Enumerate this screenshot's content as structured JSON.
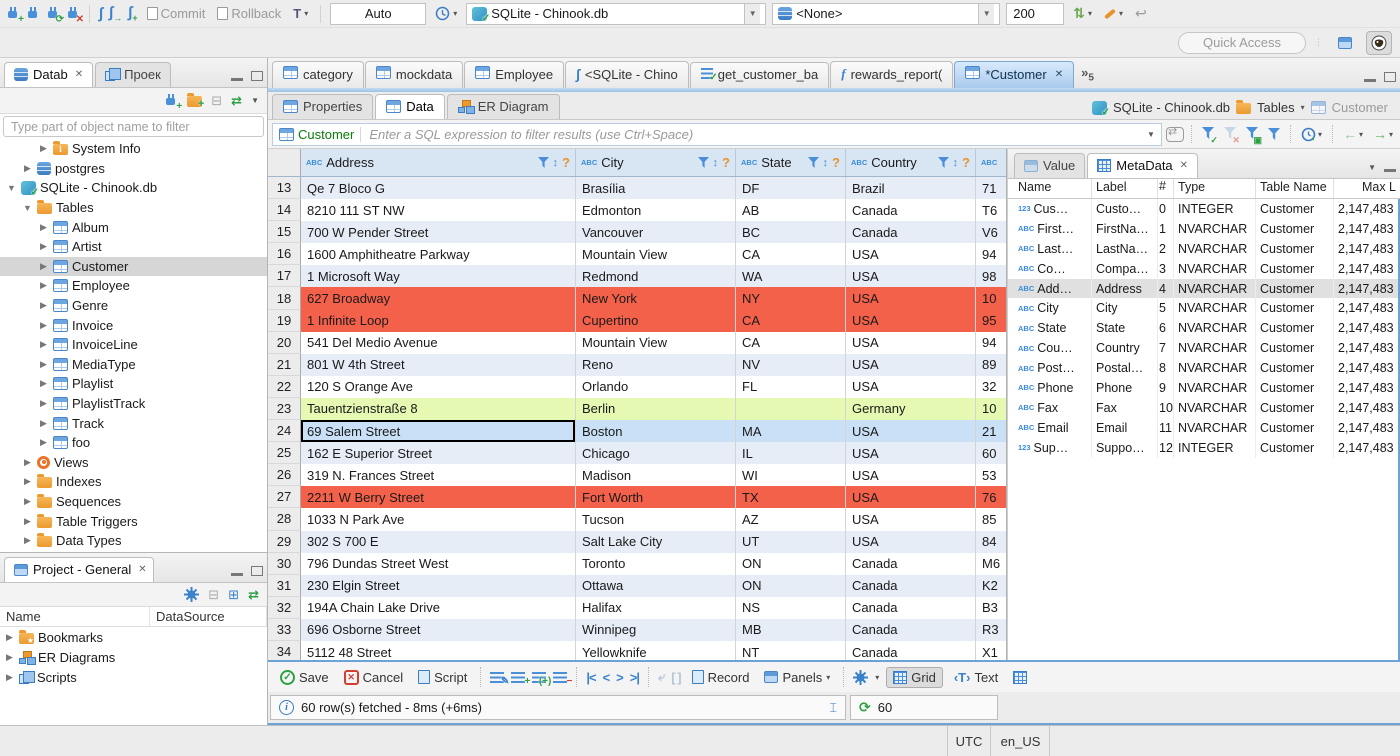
{
  "toolbar": {
    "commit_label": "Commit",
    "rollback_label": "Rollback",
    "txn_mode": "Auto",
    "connection_value": "SQLite - Chinook.db",
    "schema_value": "<None>",
    "fetch_size": "200"
  },
  "quick_access": {
    "placeholder": "Quick Access"
  },
  "navigator": {
    "tab_database": "Datab",
    "tab_project": "Проек",
    "filter_placeholder": "Type part of object name to filter",
    "tree": [
      {
        "exp": "▶",
        "icon": "i-folder i-folder-info",
        "label": "System Info",
        "lvl": 2
      },
      {
        "exp": "▶",
        "icon": "i-db",
        "label": "postgres",
        "lvl": 1
      },
      {
        "exp": "▼",
        "icon": "i-db-green",
        "label": "SQLite - Chinook.db",
        "lvl": 0
      },
      {
        "exp": "▼",
        "icon": "i-folder",
        "label": "Tables",
        "lvl": 1
      },
      {
        "exp": "▶",
        "icon": "i-table",
        "label": "Album",
        "lvl": 2
      },
      {
        "exp": "▶",
        "icon": "i-table",
        "label": "Artist",
        "lvl": 2
      },
      {
        "exp": "▶",
        "icon": "i-table",
        "label": "Customer",
        "lvl": 2,
        "cls": "selected"
      },
      {
        "exp": "▶",
        "icon": "i-table",
        "label": "Employee",
        "lvl": 2
      },
      {
        "exp": "▶",
        "icon": "i-table",
        "label": "Genre",
        "lvl": 2
      },
      {
        "exp": "▶",
        "icon": "i-table",
        "label": "Invoice",
        "lvl": 2
      },
      {
        "exp": "▶",
        "icon": "i-table",
        "label": "InvoiceLine",
        "lvl": 2
      },
      {
        "exp": "▶",
        "icon": "i-table",
        "label": "MediaType",
        "lvl": 2
      },
      {
        "exp": "▶",
        "icon": "i-table",
        "label": "Playlist",
        "lvl": 2
      },
      {
        "exp": "▶",
        "icon": "i-table",
        "label": "PlaylistTrack",
        "lvl": 2
      },
      {
        "exp": "▶",
        "icon": "i-table",
        "label": "Track",
        "lvl": 2
      },
      {
        "exp": "▶",
        "icon": "i-table",
        "label": "foo",
        "lvl": 2
      },
      {
        "exp": "▶",
        "icon": "i-eye",
        "label": "Views",
        "lvl": 1
      },
      {
        "exp": "▶",
        "icon": "i-folder",
        "label": "Indexes",
        "lvl": 1
      },
      {
        "exp": "▶",
        "icon": "i-folder",
        "label": "Sequences",
        "lvl": 1
      },
      {
        "exp": "▶",
        "icon": "i-folder",
        "label": "Table Triggers",
        "lvl": 1
      },
      {
        "exp": "▶",
        "icon": "i-folder",
        "label": "Data Types",
        "lvl": 1
      }
    ]
  },
  "project_panel": {
    "title": "Project - General",
    "col_name": "Name",
    "col_datasource": "DataSource",
    "items": [
      {
        "icon": "i-folder i-folder-star",
        "label": "Bookmarks"
      },
      {
        "icon": "i-er",
        "label": "ER Diagrams"
      },
      {
        "icon": "i-pages",
        "label": "Scripts"
      }
    ]
  },
  "editor": {
    "tabs": [
      {
        "icon": "table",
        "label": "category"
      },
      {
        "icon": "table",
        "label": "mockdata"
      },
      {
        "icon": "table",
        "label": "Employee"
      },
      {
        "icon": "sql",
        "label": "<SQLite - Chino"
      },
      {
        "icon": "script",
        "label": "get_customer_ba"
      },
      {
        "icon": "func",
        "label": "rewards_report("
      },
      {
        "icon": "table",
        "label": "*Customer",
        "cls": "active",
        "close": "✕"
      }
    ],
    "overflow_count": "5",
    "subtabs": {
      "properties": "Properties",
      "data": "Data",
      "er": "ER Diagram"
    },
    "breadcrumb": {
      "connection": "SQLite - Chinook.db",
      "container": "Tables",
      "entity": "Customer"
    }
  },
  "filter_bar": {
    "entity": "Customer",
    "placeholder": "Enter a SQL expression to filter results (use Ctrl+Space)"
  },
  "grid": {
    "columns": [
      {
        "label": "Address"
      },
      {
        "label": "City"
      },
      {
        "label": "State"
      },
      {
        "label": "Country"
      }
    ],
    "rows": [
      {
        "n": "13",
        "address": "Qe 7 Bloco G",
        "city": "Brasília",
        "state": "DF",
        "country": "Brazil",
        "postal": "71",
        "cls": "alt"
      },
      {
        "n": "14",
        "address": "8210 111 ST NW",
        "city": "Edmonton",
        "state": "AB",
        "country": "Canada",
        "postal": "T6",
        "cls": ""
      },
      {
        "n": "15",
        "address": "700 W Pender Street",
        "city": "Vancouver",
        "state": "BC",
        "country": "Canada",
        "postal": "V6",
        "cls": "alt"
      },
      {
        "n": "16",
        "address": "1600 Amphitheatre Parkway",
        "city": "Mountain View",
        "state": "CA",
        "country": "USA",
        "postal": "94",
        "cls": ""
      },
      {
        "n": "17",
        "address": "1 Microsoft Way",
        "city": "Redmond",
        "state": "WA",
        "country": "USA",
        "postal": "98",
        "cls": "alt"
      },
      {
        "n": "18",
        "address": "627 Broadway",
        "city": "New York",
        "state": "NY",
        "country": "USA",
        "postal": "10",
        "cls": "red"
      },
      {
        "n": "19",
        "address": "1 Infinite Loop",
        "city": "Cupertino",
        "state": "CA",
        "country": "USA",
        "postal": "95",
        "cls": "red"
      },
      {
        "n": "20",
        "address": "541 Del Medio Avenue",
        "city": "Mountain View",
        "state": "CA",
        "country": "USA",
        "postal": "94",
        "cls": ""
      },
      {
        "n": "21",
        "address": "801 W 4th Street",
        "city": "Reno",
        "state": "NV",
        "country": "USA",
        "postal": "89",
        "cls": "alt"
      },
      {
        "n": "22",
        "address": "120 S Orange Ave",
        "city": "Orlando",
        "state": "FL",
        "country": "USA",
        "postal": "32",
        "cls": ""
      },
      {
        "n": "23",
        "address": "Tauentzienstraße 8",
        "city": "Berlin",
        "state": "",
        "country": "Germany",
        "postal": "10",
        "cls": "green"
      },
      {
        "n": "24",
        "address": "69 Salem Street",
        "city": "Boston",
        "state": "MA",
        "country": "USA",
        "postal": "21",
        "cls": "sel",
        "acls": "cell-focus"
      },
      {
        "n": "25",
        "address": "162 E Superior Street",
        "city": "Chicago",
        "state": "IL",
        "country": "USA",
        "postal": "60",
        "cls": "alt"
      },
      {
        "n": "26",
        "address": "319 N. Frances Street",
        "city": "Madison",
        "state": "WI",
        "country": "USA",
        "postal": "53",
        "cls": ""
      },
      {
        "n": "27",
        "address": "2211 W Berry Street",
        "city": "Fort Worth",
        "state": "TX",
        "country": "USA",
        "postal": "76",
        "cls": "red"
      },
      {
        "n": "28",
        "address": "1033 N Park Ave",
        "city": "Tucson",
        "state": "AZ",
        "country": "USA",
        "postal": "85",
        "cls": ""
      },
      {
        "n": "29",
        "address": "302 S 700 E",
        "city": "Salt Lake City",
        "state": "UT",
        "country": "USA",
        "postal": "84",
        "cls": "alt"
      },
      {
        "n": "30",
        "address": "796 Dundas Street West",
        "city": "Toronto",
        "state": "ON",
        "country": "Canada",
        "postal": "M6",
        "cls": ""
      },
      {
        "n": "31",
        "address": "230 Elgin Street",
        "city": "Ottawa",
        "state": "ON",
        "country": "Canada",
        "postal": "K2",
        "cls": "alt"
      },
      {
        "n": "32",
        "address": "194A Chain Lake Drive",
        "city": "Halifax",
        "state": "NS",
        "country": "Canada",
        "postal": "B3",
        "cls": ""
      },
      {
        "n": "33",
        "address": "696 Osborne Street",
        "city": "Winnipeg",
        "state": "MB",
        "country": "Canada",
        "postal": "R3",
        "cls": "alt"
      },
      {
        "n": "34",
        "address": "5112 48 Street",
        "city": "Yellowknife",
        "state": "NT",
        "country": "Canada",
        "postal": "X1",
        "cls": ""
      }
    ]
  },
  "side_panel": {
    "tab_value": "Value",
    "tab_metadata": "MetaData",
    "columns": {
      "name": "Name",
      "label": "Label",
      "num": "#",
      "type": "Type",
      "table": "Table Name",
      "max": "Max L"
    },
    "rows": [
      {
        "icon": "123",
        "name": "Cus…",
        "label": "Custo…",
        "num": "0",
        "type": "INTEGER",
        "table": "Customer",
        "max": "2,147,483",
        "cls": ""
      },
      {
        "icon": "ABC",
        "name": "First…",
        "label": "FirstNa…",
        "num": "1",
        "type": "NVARCHAR",
        "table": "Customer",
        "max": "2,147,483",
        "cls": ""
      },
      {
        "icon": "ABC",
        "name": "Last…",
        "label": "LastNa…",
        "num": "2",
        "type": "NVARCHAR",
        "table": "Customer",
        "max": "2,147,483",
        "cls": ""
      },
      {
        "icon": "ABC",
        "name": "Co…",
        "label": "Compa…",
        "num": "3",
        "type": "NVARCHAR",
        "table": "Customer",
        "max": "2,147,483",
        "cls": ""
      },
      {
        "icon": "ABC",
        "name": "Add…",
        "label": "Address",
        "num": "4",
        "type": "NVARCHAR",
        "table": "Customer",
        "max": "2,147,483",
        "cls": "selected"
      },
      {
        "icon": "ABC",
        "name": "City",
        "label": "City",
        "num": "5",
        "type": "NVARCHAR",
        "table": "Customer",
        "max": "2,147,483",
        "cls": ""
      },
      {
        "icon": "ABC",
        "name": "State",
        "label": "State",
        "num": "6",
        "type": "NVARCHAR",
        "table": "Customer",
        "max": "2,147,483",
        "cls": ""
      },
      {
        "icon": "ABC",
        "name": "Cou…",
        "label": "Country",
        "num": "7",
        "type": "NVARCHAR",
        "table": "Customer",
        "max": "2,147,483",
        "cls": ""
      },
      {
        "icon": "ABC",
        "name": "Post…",
        "label": "Postal…",
        "num": "8",
        "type": "NVARCHAR",
        "table": "Customer",
        "max": "2,147,483",
        "cls": ""
      },
      {
        "icon": "ABC",
        "name": "Phone",
        "label": "Phone",
        "num": "9",
        "type": "NVARCHAR",
        "table": "Customer",
        "max": "2,147,483",
        "cls": ""
      },
      {
        "icon": "ABC",
        "name": "Fax",
        "label": "Fax",
        "num": "10",
        "type": "NVARCHAR",
        "table": "Customer",
        "max": "2,147,483",
        "cls": ""
      },
      {
        "icon": "ABC",
        "name": "Email",
        "label": "Email",
        "num": "11",
        "type": "NVARCHAR",
        "table": "Customer",
        "max": "2,147,483",
        "cls": ""
      },
      {
        "icon": "123",
        "name": "Sup…",
        "label": "Suppo…",
        "num": "12",
        "type": "INTEGER",
        "table": "Customer",
        "max": "2,147,483",
        "cls": ""
      }
    ]
  },
  "bottom_toolbar": {
    "save": "Save",
    "cancel": "Cancel",
    "script": "Script",
    "record": "Record",
    "panels": "Panels",
    "grid": "Grid",
    "text": "Text"
  },
  "status_row": {
    "fetched": "60 row(s) fetched - 8ms (+6ms)",
    "refresh_count": "60"
  },
  "status_bar": {
    "timezone": "UTC",
    "locale": "en_US"
  }
}
